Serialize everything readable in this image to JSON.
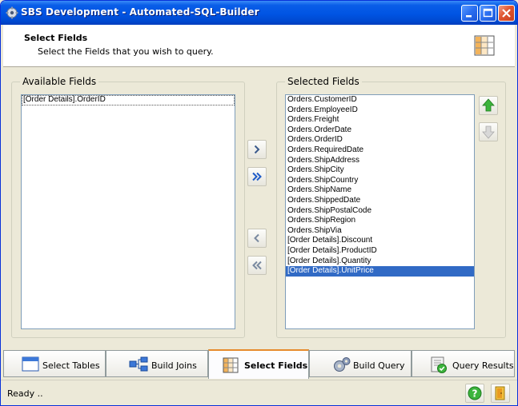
{
  "window": {
    "title": "SBS Development - Automated-SQL-Builder"
  },
  "header": {
    "title": "Select Fields",
    "subtitle": "Select the Fields that you wish to query.",
    "icon": "grid-table-icon"
  },
  "available": {
    "legend": "Available Fields",
    "items": [
      "[Order Details].OrderID"
    ]
  },
  "selected": {
    "legend": "Selected Fields",
    "items": [
      "Orders.CustomerID",
      "Orders.EmployeeID",
      "Orders.Freight",
      "Orders.OrderDate",
      "Orders.OrderID",
      "Orders.RequiredDate",
      "Orders.ShipAddress",
      "Orders.ShipCity",
      "Orders.ShipCountry",
      "Orders.ShipName",
      "Orders.ShippedDate",
      "Orders.ShipPostalCode",
      "Orders.ShipRegion",
      "Orders.ShipVia",
      "[Order Details].Discount",
      "[Order Details].ProductID",
      "[Order Details].Quantity",
      "[Order Details].UnitPrice"
    ],
    "selected_item": "[Order Details].UnitPrice"
  },
  "move_buttons": {
    "add": "›",
    "add_all": "»",
    "remove": "‹",
    "remove_all": "«"
  },
  "tabs": [
    {
      "label": "Select Tables",
      "icon": "window-icon"
    },
    {
      "label": "Build Joins",
      "icon": "joins-icon"
    },
    {
      "label": "Select Fields",
      "icon": "grid-table-icon",
      "active": true
    },
    {
      "label": "Build Query",
      "icon": "gears-icon"
    },
    {
      "label": "Query Results",
      "icon": "results-check-icon"
    }
  ],
  "status": {
    "text": "Ready .."
  },
  "colors": {
    "selection": "#316ac5",
    "title_bar": "#0054e3",
    "active_tab_accent": "#e68b2c",
    "arrow_green": "#2ea02e"
  }
}
